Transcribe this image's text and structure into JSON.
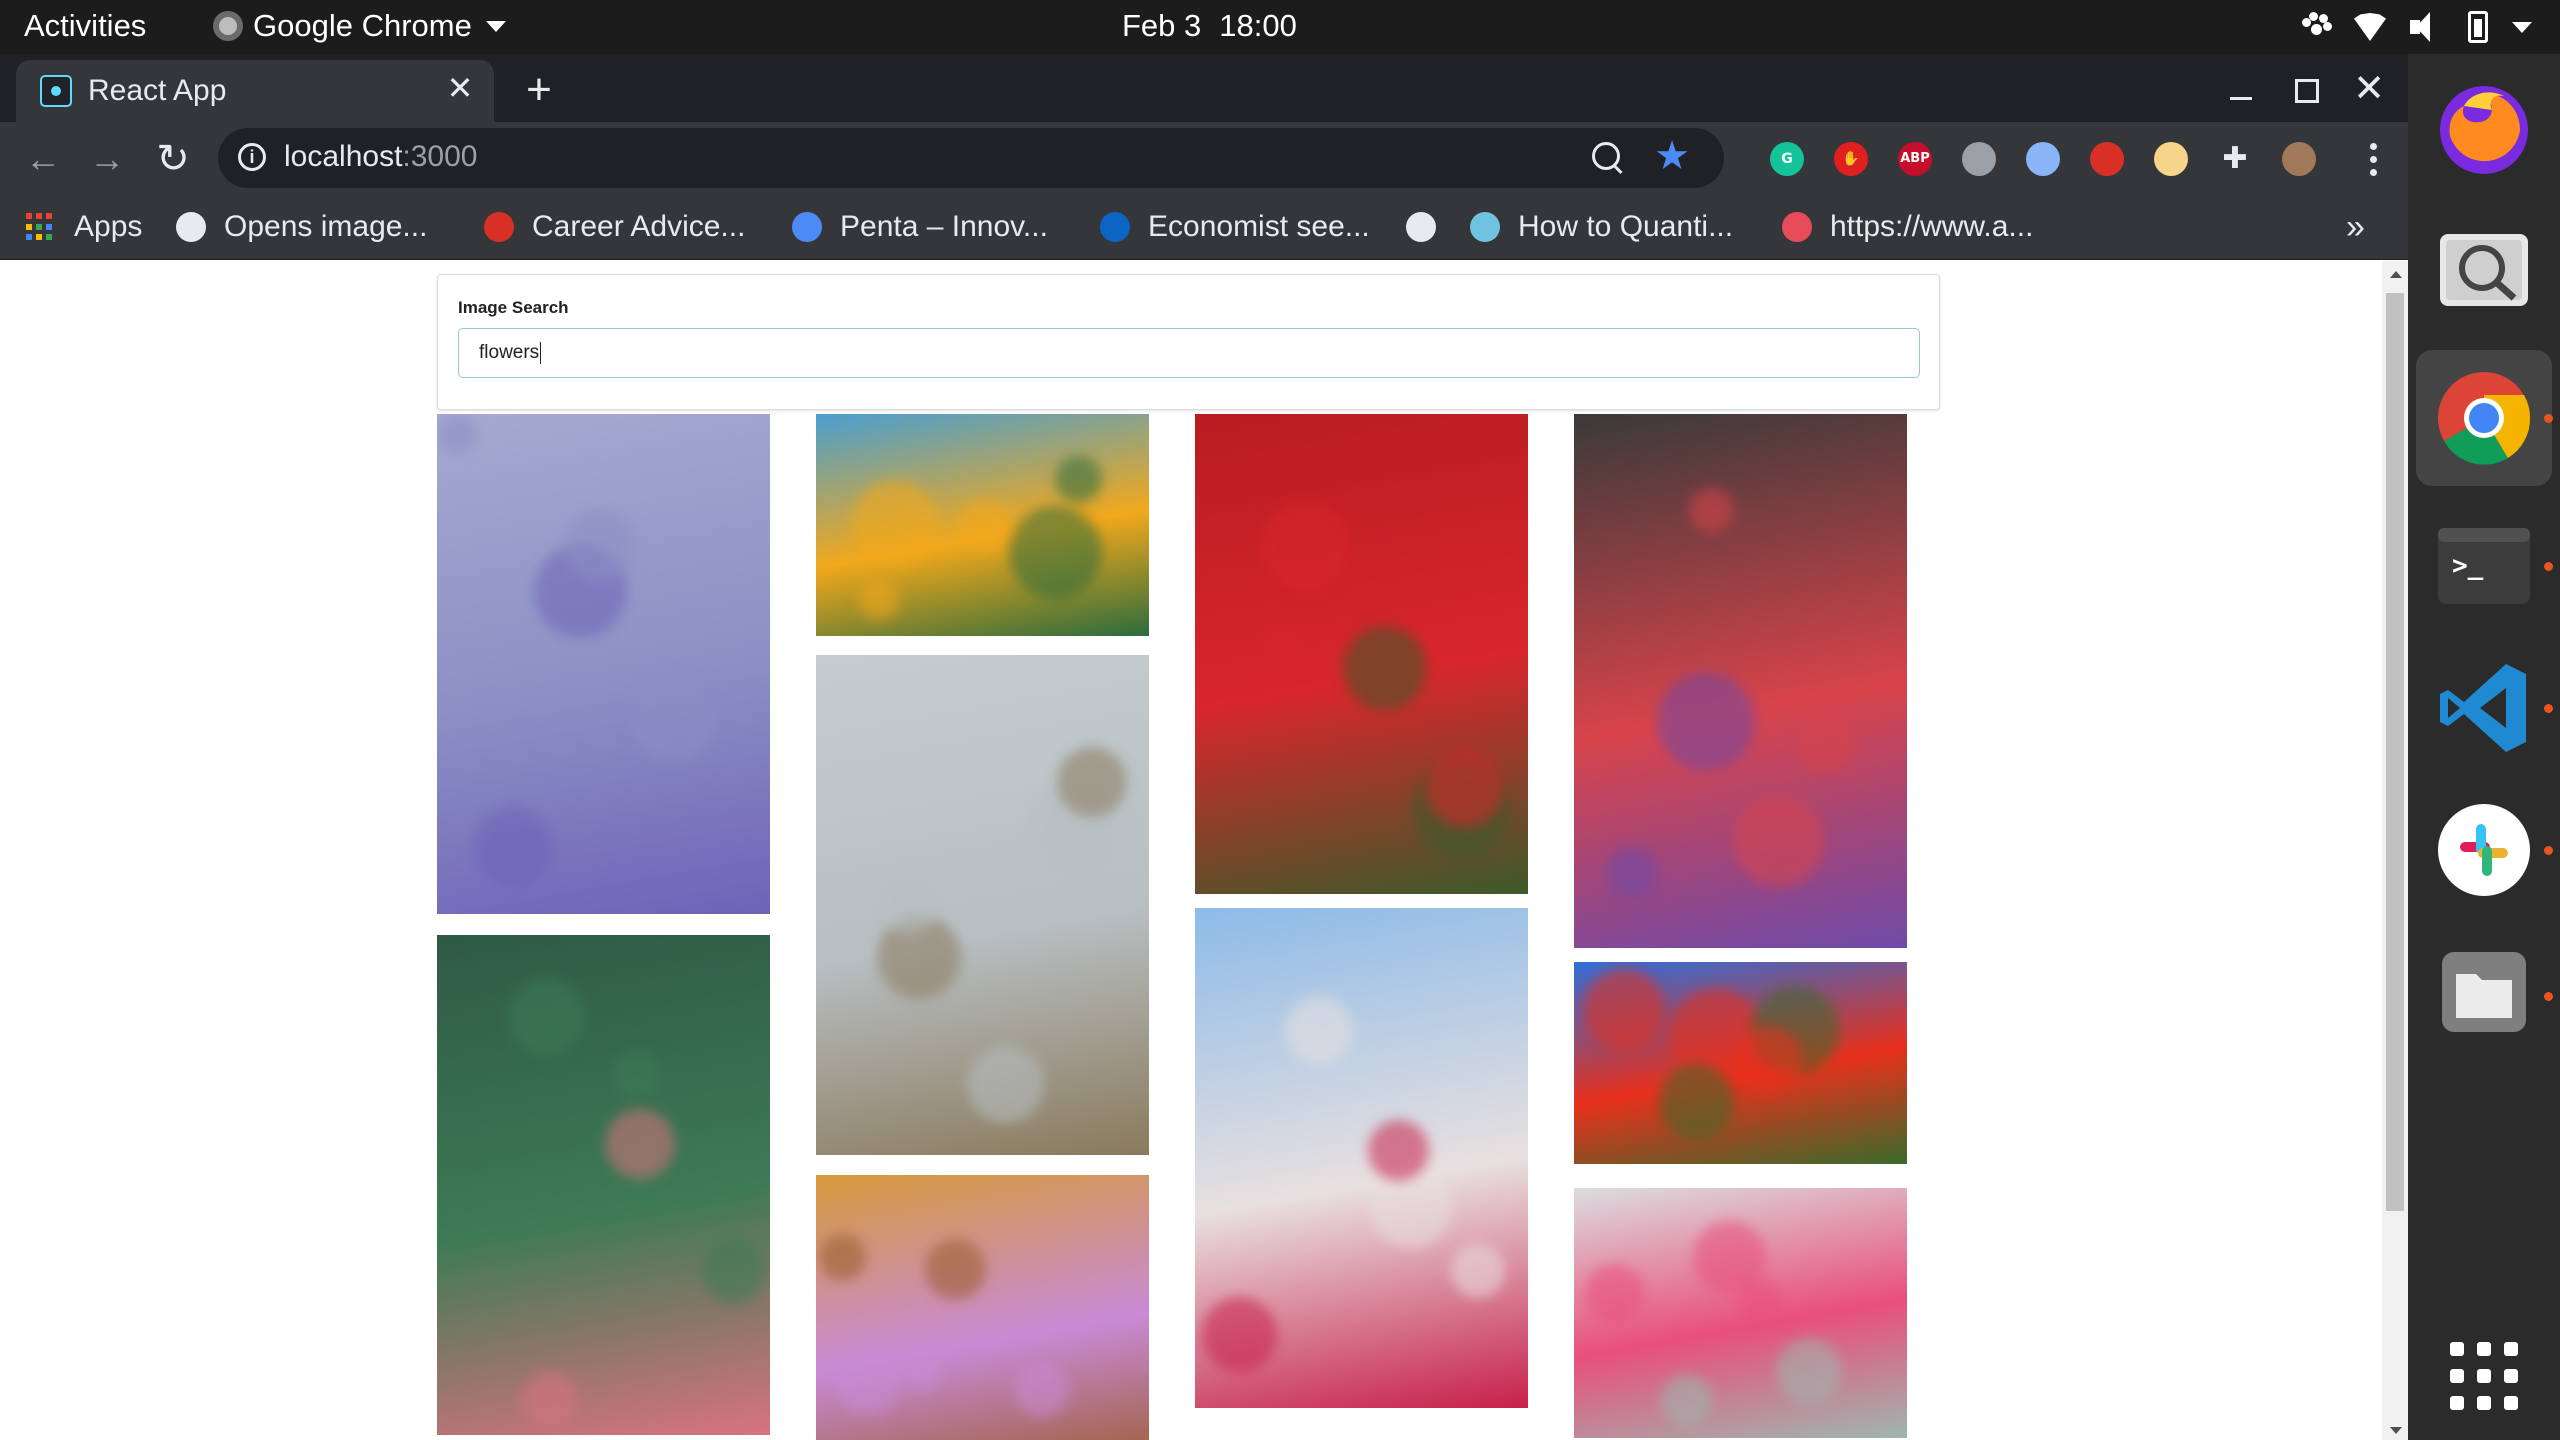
{
  "topbar": {
    "activities": "Activities",
    "app_name": "Google Chrome",
    "date": "Feb 3",
    "time": "18:00"
  },
  "tab": {
    "title": "React App",
    "close": "✕",
    "new_tab": "+"
  },
  "window_controls": {
    "close": "✕"
  },
  "toolbar": {
    "back": "←",
    "forward": "→",
    "reload": "↻",
    "url_host": "localhost",
    "url_port": ":3000",
    "star": "★",
    "extensions": [
      {
        "name": "grammarly-icon",
        "text": "G",
        "color": "#15c39a"
      },
      {
        "name": "hand-stop-icon",
        "text": "✋",
        "color": "#e02020"
      },
      {
        "name": "adblock-plus-icon",
        "text": "ABP",
        "color": "#c70d2c"
      },
      {
        "name": "mouse-extension-icon",
        "text": "",
        "color": "#9aa0a6"
      },
      {
        "name": "circle-extension-icon",
        "text": "",
        "color": "#8ab4f8"
      },
      {
        "name": "red-extension-icon",
        "text": "",
        "color": "#d93025"
      },
      {
        "name": "sun-extension-icon",
        "text": "",
        "color": "#f6d58b"
      },
      {
        "name": "puzzle-icon",
        "text": "✚",
        "color": "#35363a"
      },
      {
        "name": "profile-avatar",
        "text": "",
        "color": "#a0785a"
      }
    ]
  },
  "bookmarks": {
    "apps": "Apps",
    "items": [
      {
        "label": "Opens image...",
        "icon": "globe-icon",
        "color": "#e8eaed"
      },
      {
        "label": "Career Advice...",
        "icon": "chart-icon",
        "color": "#d93025"
      },
      {
        "label": "Penta – Innov...",
        "icon": "penta-icon",
        "color": "#4c8bf5"
      },
      {
        "label": "Economist see...",
        "icon": "linkedin-icon",
        "color": "#0a66c2"
      },
      {
        "label": "",
        "icon": "globe-icon",
        "color": "#e8eaed"
      },
      {
        "label": "How to Quanti...",
        "icon": "m-logo-icon",
        "color": "#6fc3e0"
      },
      {
        "label": "https://www.a...",
        "icon": "a-logo-icon",
        "color": "#e84b5a"
      }
    ],
    "more": "»"
  },
  "page": {
    "search_label": "Image Search",
    "search_value": "flowers"
  },
  "photos": [
    {
      "name": "photo-lavender",
      "colors": [
        "#a6a9d0",
        "#8b8fc4",
        "#6e63b8"
      ]
    },
    {
      "name": "photo-calla-lily",
      "colors": [
        "#2f5a45",
        "#3d7a55",
        "#d9737e"
      ]
    },
    {
      "name": "photo-yellow-poppies",
      "colors": [
        "#4a9fd0",
        "#f2a81b",
        "#2c6c3e"
      ]
    },
    {
      "name": "photo-wildflowers",
      "colors": [
        "#c4ccd0",
        "#b8bfc3",
        "#8a7a5c"
      ]
    },
    {
      "name": "photo-purple-crocus",
      "colors": [
        "#d69a3c",
        "#c98ad6",
        "#9a5b2c"
      ]
    },
    {
      "name": "photo-red-begonias",
      "colors": [
        "#b81c22",
        "#d8262b",
        "#3c5a2a"
      ]
    },
    {
      "name": "photo-tulips",
      "colors": [
        "#8dbbe8",
        "#e8e0e0",
        "#c8204a"
      ]
    },
    {
      "name": "photo-dark-bouquet",
      "colors": [
        "#3a3a3a",
        "#d8434a",
        "#6f4aa8"
      ]
    },
    {
      "name": "photo-poppy-field",
      "colors": [
        "#2e6fd8",
        "#e8301c",
        "#3b6a2a"
      ]
    },
    {
      "name": "photo-vase-bouquet",
      "colors": [
        "#dcdde0",
        "#e94f7a",
        "#9fb6b0"
      ]
    }
  ]
}
